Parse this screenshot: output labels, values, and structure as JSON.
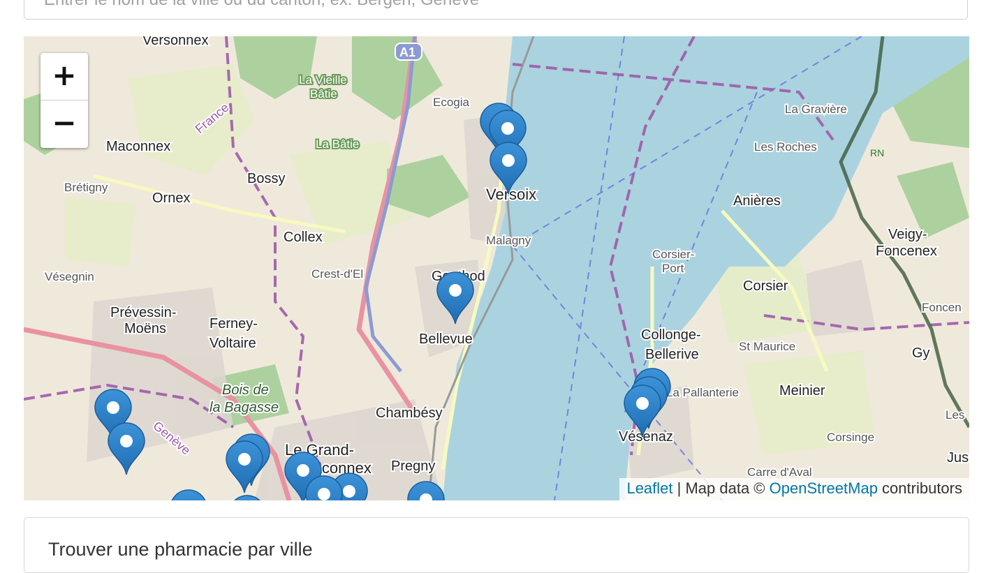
{
  "search": {
    "placeholder": "Entrer le nom de la ville ou du canton, ex: Bergen, Genève"
  },
  "map": {
    "zoom_in_label": "+",
    "zoom_out_label": "−",
    "attribution": {
      "leaflet": "Leaflet",
      "separator": " | Map data © ",
      "osm": "OpenStreetMap",
      "suffix": " contributors"
    },
    "place_labels": [
      "Versonnex",
      "Maconnex",
      "Bossy",
      "Brétigny",
      "Ornex",
      "Collex",
      "Vésegnin",
      "Prévessin-",
      "Moëns",
      "Ferney-",
      "Voltaire",
      "Bois de",
      "la Bagasse",
      "La Vieille",
      "Bâtie",
      "La Bâtie",
      "Ecogia",
      "Versoix",
      "Malagny",
      "Crest-d'El",
      "Genthod",
      "Bellevue",
      "Chambésy",
      "Le Grand-",
      "Saconnex",
      "Pregny",
      "Genève",
      "France",
      "Corsier-",
      "Port",
      "Corsier",
      "Anières",
      "La Gravière",
      "Les Roches",
      "Veigy-",
      "Foncenex",
      "Collonge-",
      "Bellerive",
      "St Maurice",
      "Meinier",
      "Gy",
      "Vésenaz",
      "Corsinge",
      "Carre d'Aval",
      "Jus",
      "Les",
      "La Pallanterie",
      "A1",
      "RN",
      "Foncen"
    ],
    "marker_count": 20,
    "colors": {
      "water": "#aad3df",
      "land": "#efe9dc",
      "marker": "#2a81cb",
      "border": "#9e5aa8"
    }
  },
  "panel": {
    "title": "Trouver une pharmacie par ville"
  }
}
